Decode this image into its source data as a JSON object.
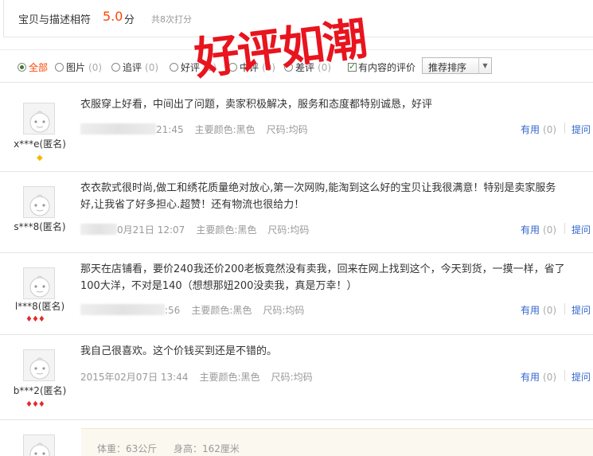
{
  "score": {
    "label": "宝贝与描述相符",
    "value": "5.0",
    "unit": "分",
    "count": "共8次打分"
  },
  "stamp": "好评如潮",
  "filters": [
    {
      "label": "全部",
      "count": "",
      "active": true
    },
    {
      "label": "图片",
      "count": "(0)"
    },
    {
      "label": "追评",
      "count": "(0)"
    },
    {
      "label": "好评",
      "count": "(0)"
    },
    {
      "label": "中评",
      "count": "(0)"
    },
    {
      "label": "差评",
      "count": "(0)"
    }
  ],
  "has_content": "有内容的评价",
  "sort": "推荐排序",
  "reviews": [
    {
      "content": [
        "衣服穿上好看，中间出了问题，卖家积极解决，服务和态度都特别诚恳，好评"
      ],
      "time": "21:45",
      "color": "主要颜色:黑色",
      "size": "尺码:均码",
      "nick": "x***e(匿名)",
      "badge": "◆",
      "badge_type": "gold"
    },
    {
      "content": [
        "衣衣款式很时尚,做工和绣花质量绝对放心,第一次网购,能淘到这么好的宝贝让我很满意！特别是卖家服务",
        "好,让我省了好多担心.超赞！还有物流也很给力！"
      ],
      "time": "0月21日 12:07",
      "color": "主要颜色:黑色",
      "size": "尺码:均码",
      "nick": "s***8(匿名)",
      "badge": "",
      "badge_type": ""
    },
    {
      "content": [
        "那天在店铺看，要价240我还价200老板竟然没有卖我，回来在网上找到这个，今天到货，一摸一样，省了",
        "100大洋，不对是140（想想那妞200没卖我，真是万幸！）"
      ],
      "time": ":56",
      "color": "主要颜色:黑色",
      "size": "尺码:均码",
      "nick": "l***8(匿名)",
      "badge": "♦♦♦",
      "badge_type": "red"
    },
    {
      "content": [
        "我自己很喜欢。这个价钱买到还是不错的。"
      ],
      "time": "2015年02月07日 13:44",
      "color": "主要颜色:黑色",
      "size": "尺码:均码",
      "nick": "b***2(匿名)",
      "badge": "♦♦♦",
      "badge_type": "red"
    }
  ],
  "useful_label": "有用",
  "useful_count": "(0)",
  "reply_label": "提问",
  "info": {
    "weight": "体重：63公斤",
    "height": "身高：162厘米"
  },
  "colors": {
    "accent": "#ff4400",
    "link": "#3366cc",
    "stamp": "#e8141e"
  }
}
